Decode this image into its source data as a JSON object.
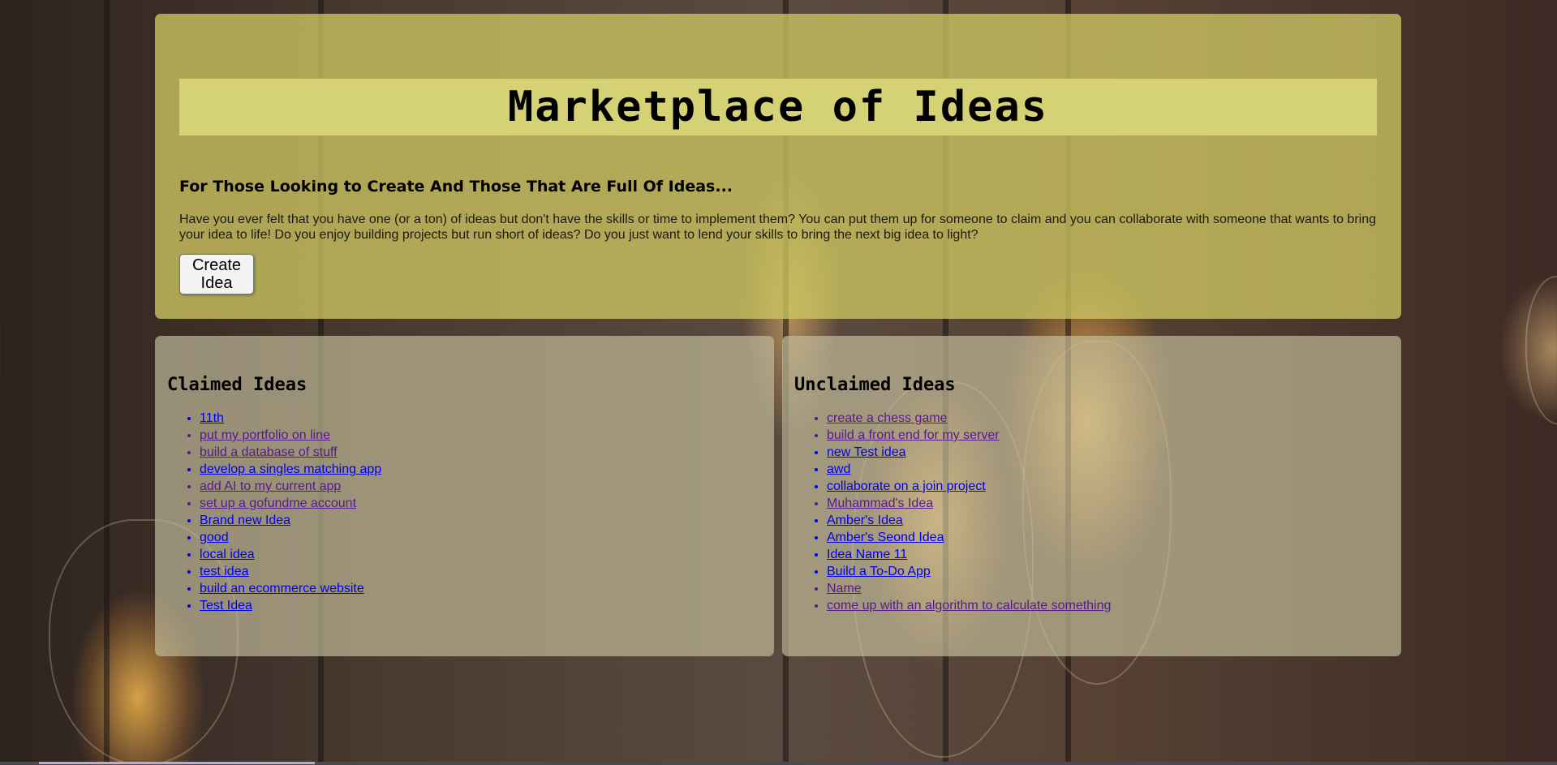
{
  "hero": {
    "title": "Marketplace of Ideas",
    "tagline": "For Those Looking to Create And Those That Are Full Of Ideas...",
    "intro": "Have you ever felt that you have one (or a ton) of ideas but don't have the skills or time to implement them? You can put them up for someone to claim and you can collaborate with someone that wants to bring your idea to life! Do you enjoy building projects but run short of ideas? Do you just want to lend your skills to bring the next big idea to light?",
    "create_button": "Create Idea"
  },
  "claimed": {
    "heading": "Claimed Ideas",
    "items": [
      {
        "label": "11th",
        "visited": false
      },
      {
        "label": "put my portfolio on line",
        "visited": true
      },
      {
        "label": "build a database of stuff",
        "visited": true
      },
      {
        "label": "develop a singles matching app",
        "visited": false
      },
      {
        "label": "add AI to my current app",
        "visited": true
      },
      {
        "label": "set up a gofundme account",
        "visited": true
      },
      {
        "label": "Brand new Idea",
        "visited": false
      },
      {
        "label": "good",
        "visited": false
      },
      {
        "label": "local idea",
        "visited": false
      },
      {
        "label": "test idea",
        "visited": false
      },
      {
        "label": "build an ecommerce website",
        "visited": false
      },
      {
        "label": "Test Idea",
        "visited": false
      }
    ]
  },
  "unclaimed": {
    "heading": "Unclaimed Ideas",
    "items": [
      {
        "label": "create a chess game",
        "visited": true
      },
      {
        "label": "build a front end for my server",
        "visited": true
      },
      {
        "label": "new Test idea",
        "visited": false
      },
      {
        "label": "awd",
        "visited": false
      },
      {
        "label": "collaborate on a join project",
        "visited": false
      },
      {
        "label": "Muhammad's Idea",
        "visited": true
      },
      {
        "label": "Amber's Idea",
        "visited": false
      },
      {
        "label": "Amber's Seond Idea",
        "visited": false
      },
      {
        "label": "Idea Name 11",
        "visited": false
      },
      {
        "label": "Build a To-Do App",
        "visited": false
      },
      {
        "label": "Name",
        "visited": true
      },
      {
        "label": "come up with an algorithm to calculate something",
        "visited": true
      }
    ]
  },
  "colors": {
    "link": "#0000ee",
    "visited_link": "#551a8b",
    "hero_panel": "#cdc662",
    "title_bar": "#d7d478",
    "list_panel": "#c4be9c"
  }
}
